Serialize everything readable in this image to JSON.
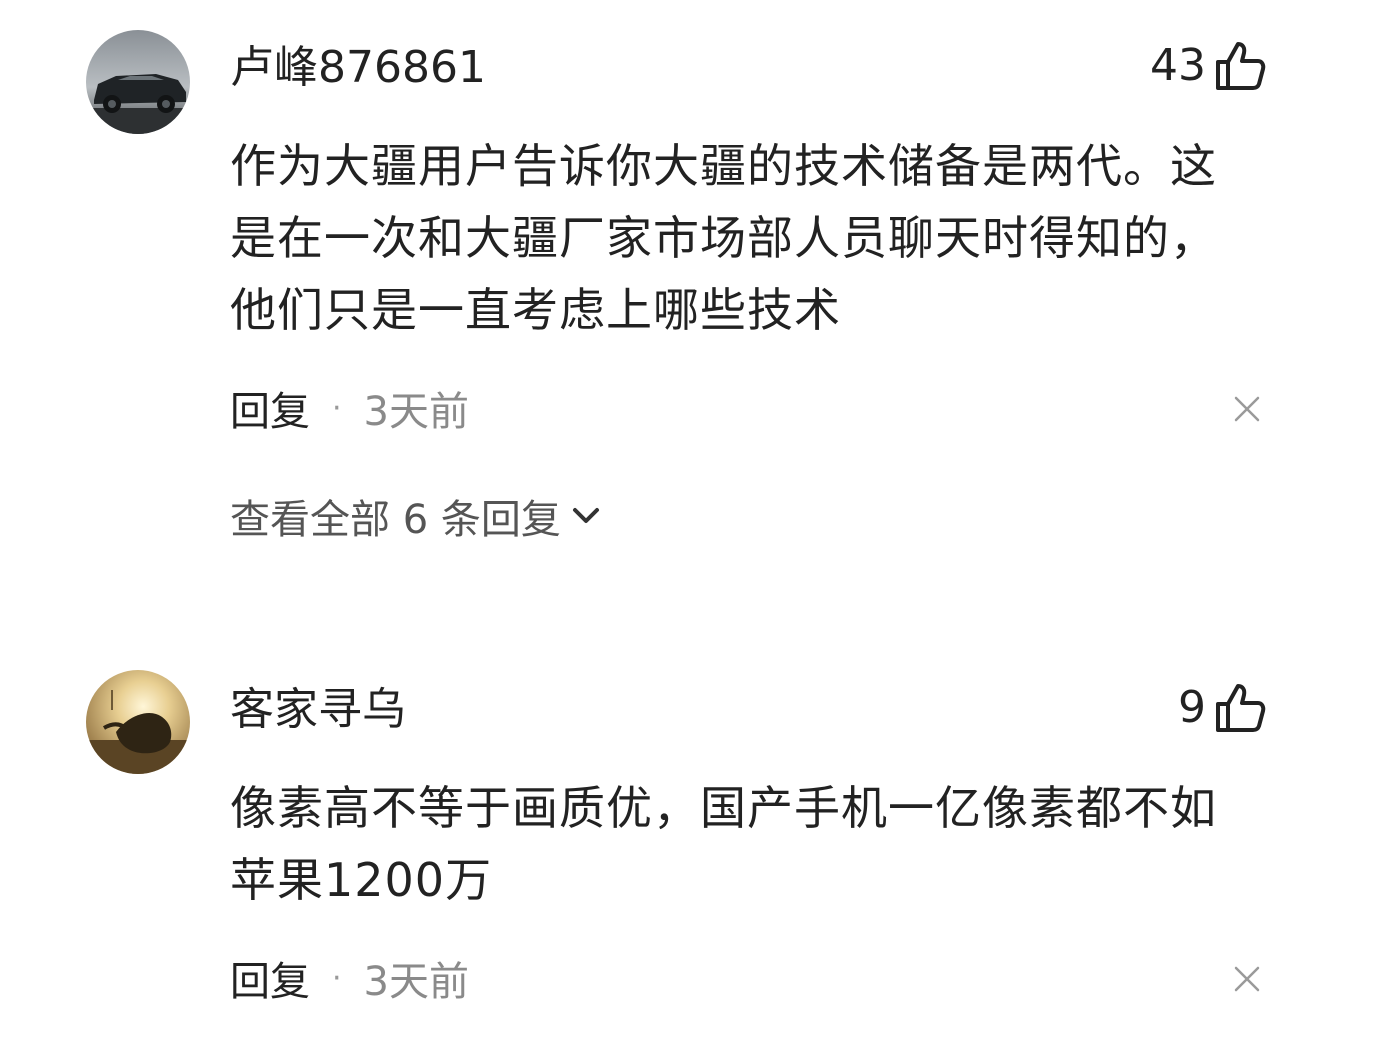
{
  "comments": [
    {
      "username": "卢峰876861",
      "likes": "43",
      "content": "作为大疆用户告诉你大疆的技术储备是两代。这是在一次和大疆厂家市场部人员聊天时得知的，他们只是一直考虑上哪些技术",
      "reply_label": "回复",
      "separator": "·",
      "time": "3天前",
      "view_replies": "查看全部 6 条回复",
      "avatar_icon": "car-avatar",
      "like_icon": "thumbs-up-icon",
      "close_icon": "close-icon"
    },
    {
      "username": "客家寻乌",
      "likes": "9",
      "content": "像素高不等于画质优，国产手机一亿像素都不如苹果1200万",
      "reply_label": "回复",
      "separator": "·",
      "time": "3天前",
      "avatar_icon": "sunset-avatar",
      "like_icon": "thumbs-up-icon",
      "close_icon": "close-icon"
    }
  ],
  "colors": {
    "text": "#222222",
    "muted": "#8a8a8a",
    "background": "#ffffff"
  }
}
